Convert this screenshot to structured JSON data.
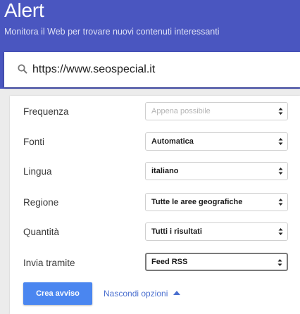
{
  "header": {
    "title": "Alert",
    "subtitle": "Monitora il Web per trovare nuovi contenuti interessanti",
    "color": "#4a56c0"
  },
  "search": {
    "icon": "search-icon",
    "value": "https://www.seospecial.it"
  },
  "options": {
    "frequency": {
      "label": "Frequenza",
      "value": "Appena possibile"
    },
    "sources": {
      "label": "Fonti",
      "value": "Automatica"
    },
    "language": {
      "label": "Lingua",
      "value": "italiano"
    },
    "region": {
      "label": "Regione",
      "value": "Tutte le aree geografiche"
    },
    "quantity": {
      "label": "Quantità",
      "value": "Tutti i risultati"
    },
    "deliver_to": {
      "label": "Invia tramite",
      "value": "Feed RSS"
    }
  },
  "actions": {
    "create_label": "Crea avviso",
    "create_color": "#4a86f0",
    "toggle_label": "Nascondi opzioni",
    "toggle_icon": "caret-up-icon"
  }
}
